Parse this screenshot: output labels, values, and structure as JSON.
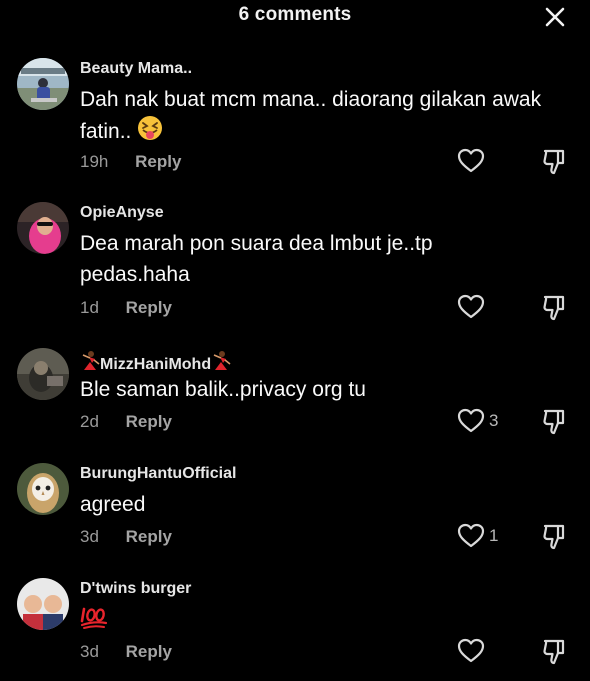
{
  "header": {
    "title": "6 comments"
  },
  "comments": [
    {
      "username": "Beauty Mama..",
      "text": "Dah nak buat mcm mana.. diaorang gilakan awak fatin..",
      "emoji": "squinting-face-with-tongue",
      "time": "19h",
      "reply_label": "Reply",
      "like_count": ""
    },
    {
      "username": "OpieAnyse",
      "text": "Dea marah pon suara dea lmbut je..tp pedas.haha",
      "time": "1d",
      "reply_label": "Reply",
      "like_count": ""
    },
    {
      "username": "MizzHaniMohd",
      "name_emoji": "dancer",
      "text": "Ble saman balik..privacy org tu",
      "time": "2d",
      "reply_label": "Reply",
      "like_count": "3"
    },
    {
      "username": "BurungHantuOfficial",
      "text": "agreed",
      "time": "3d",
      "reply_label": "Reply",
      "like_count": "1"
    },
    {
      "username": "D'twins burger",
      "text": "",
      "emoji": "hundred-points",
      "time": "3d",
      "reply_label": "Reply",
      "like_count": ""
    }
  ],
  "colors": {
    "background": "#000000",
    "text_primary": "#fafafa",
    "text_secondary": "#9a9a9a",
    "emoji_red": "#e8242c"
  },
  "icons": {
    "close": "close-icon",
    "like": "heart-outline-icon",
    "dislike": "thumbs-down-icon"
  }
}
